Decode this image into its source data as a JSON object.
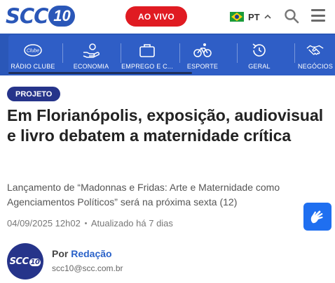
{
  "header": {
    "logo_text": "SCC",
    "logo_number": "10",
    "live_button": "AO VIVO",
    "language": "PT",
    "icons": {
      "search": "search-icon",
      "menu": "hamburger-menu-icon",
      "flag": "brazil-flag-icon",
      "language_toggle": "chevron-up-icon"
    }
  },
  "categories": [
    {
      "label": "RÁDIO CLUBE",
      "icon": "radio-clube-icon"
    },
    {
      "label": "ECONOMIA",
      "icon": "money-hand-icon"
    },
    {
      "label": "EMPREGO E C...",
      "icon": "briefcase-icon"
    },
    {
      "label": "ESPORTE",
      "icon": "bicycle-icon"
    },
    {
      "label": "GERAL",
      "icon": "clock-refresh-icon"
    },
    {
      "label": "NEGÓCIOS",
      "icon": "handshake-icon"
    }
  ],
  "article": {
    "tag": "PROJETO",
    "headline": "Em Florianópolis, exposição, audiovisual e livro debatem a maternidade crítica",
    "subtitle": "Lançamento de “Madonnas e Fridas: Arte e Maternidade como Agenciamentos Políticos” será na próxima sexta (12)",
    "published": "04/09/2025 12h02",
    "updated": "Atualizado há 7 dias"
  },
  "author": {
    "prefix": "Por",
    "name": "Redação",
    "email": "scc10@scc.com.br",
    "avatar_text": "SCC",
    "avatar_number": "10"
  },
  "accessibility": {
    "icon": "sign-language-hands-icon"
  },
  "colors": {
    "brand_blue": "#2a57b8",
    "nav_blue": "#2f5ec6",
    "live_red": "#e01b22",
    "tag_navy": "#26348a",
    "link_blue": "#2a62c9",
    "access_blue": "#1f6ff0"
  }
}
